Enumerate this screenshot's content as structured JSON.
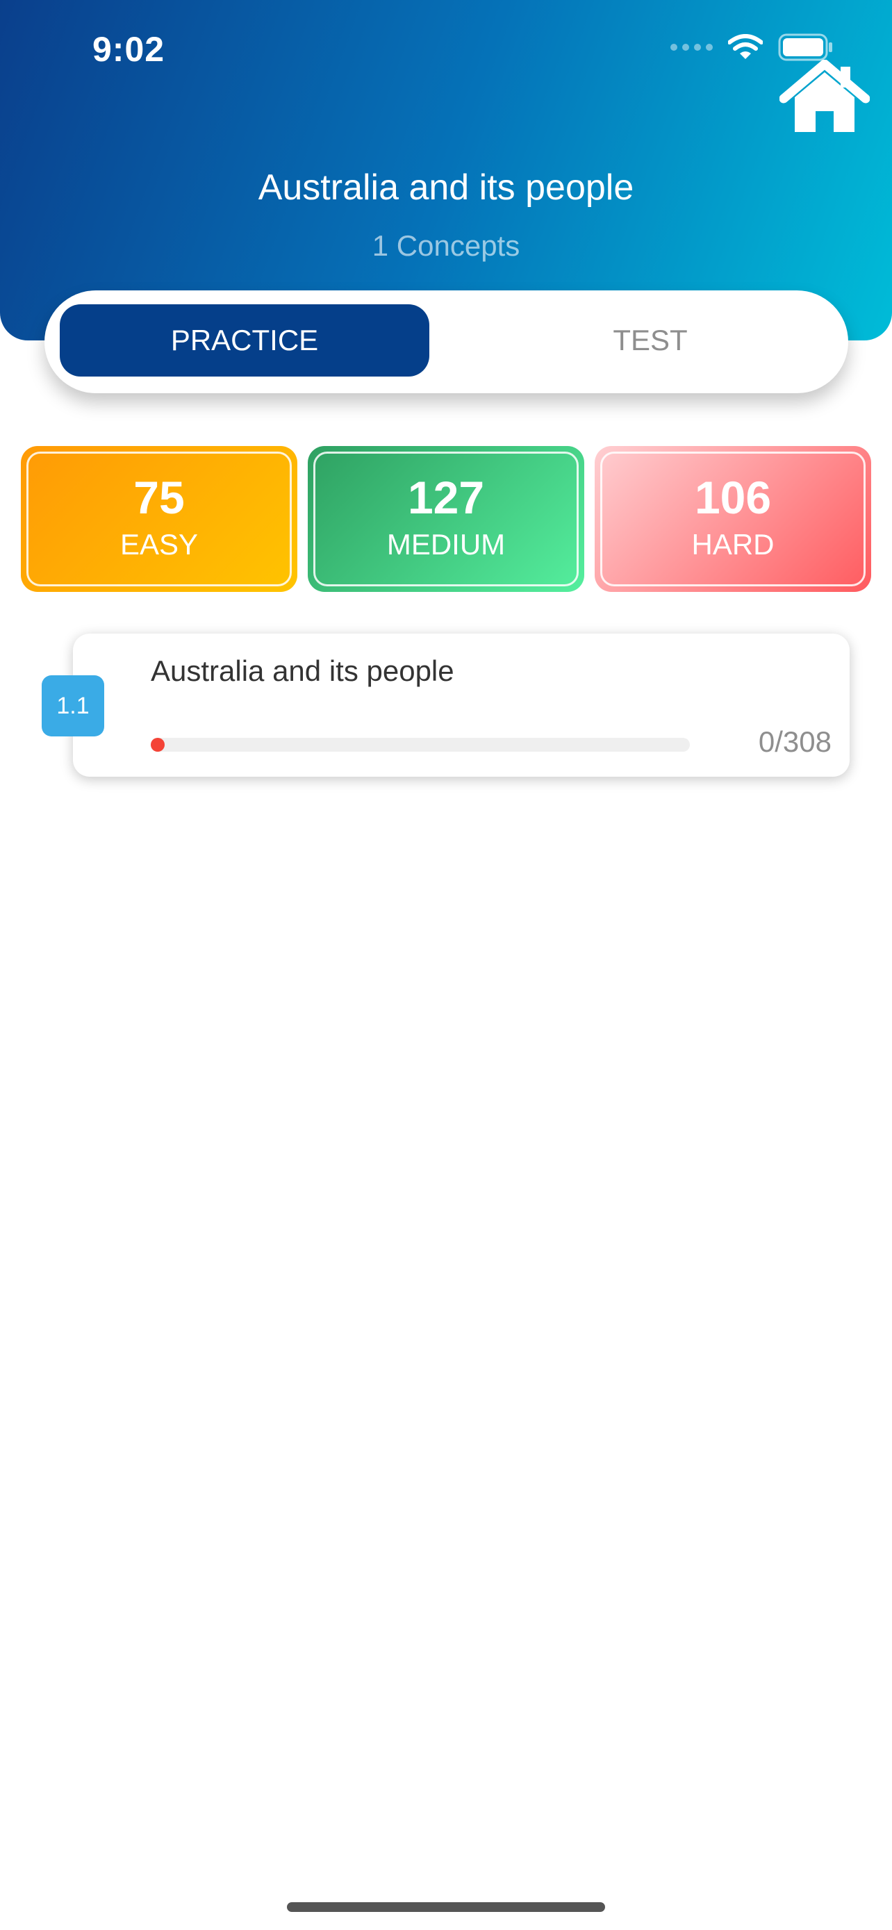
{
  "status_bar": {
    "time": "9:02"
  },
  "header": {
    "title": "Australia and its people",
    "subtitle": "1 Concepts"
  },
  "icons": {
    "home": "home-icon",
    "wifi": "wifi-icon",
    "battery": "battery-icon"
  },
  "tabs": [
    {
      "label": "PRACTICE",
      "selected": true
    },
    {
      "label": "TEST",
      "selected": false
    }
  ],
  "difficulty": [
    {
      "count": "75",
      "label": "EASY"
    },
    {
      "count": "127",
      "label": "MEDIUM"
    },
    {
      "count": "106",
      "label": "HARD"
    }
  ],
  "concepts": [
    {
      "badge": "1.1",
      "title": "Australia and its people",
      "progress_text": "0/308",
      "progress_fraction": 0
    }
  ],
  "colors": {
    "header_start": "#0a3f8c",
    "header_end": "#00bcd8",
    "tab_selected": "#053f8a",
    "easy": "#ffb300",
    "medium": "#3cc47c",
    "hard": "#ff6b6f",
    "badge": "#3aabe6",
    "progress": "#f44336"
  }
}
